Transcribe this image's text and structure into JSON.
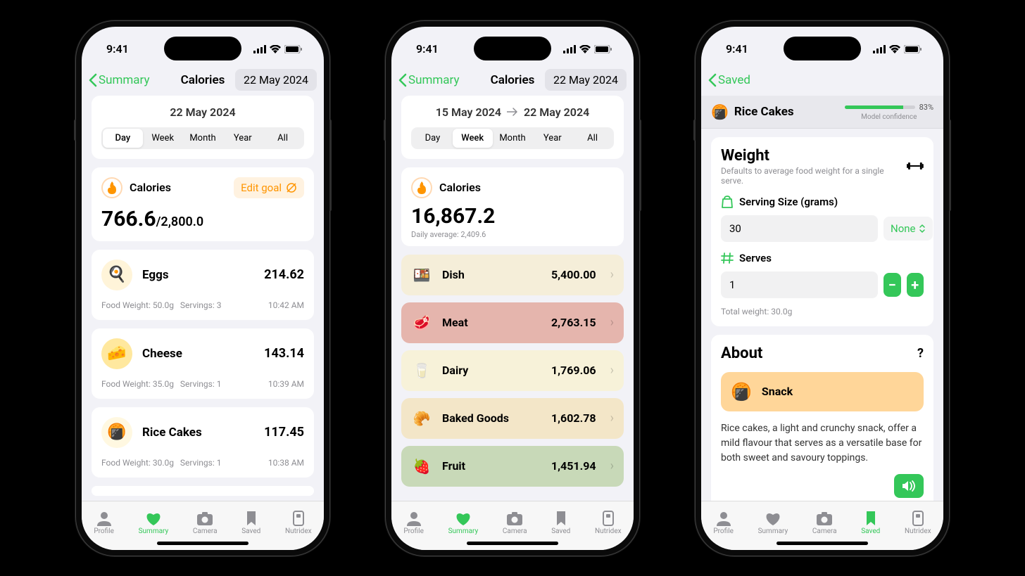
{
  "status": {
    "time": "9:41"
  },
  "nav": {
    "back": "Summary",
    "title": "Calories",
    "date_pill": "22 May 2024",
    "saved_back": "Saved"
  },
  "tabs": {
    "profile": "Profile",
    "summary": "Summary",
    "camera": "Camera",
    "saved": "Saved",
    "nutridex": "Nutridex"
  },
  "screen1": {
    "date": "22 May 2024",
    "segments": [
      "Day",
      "Week",
      "Month",
      "Year",
      "All"
    ],
    "calories_label": "Calories",
    "edit_goal": "Edit goal",
    "current": "766.6",
    "sep": "/",
    "goal": "2,800.0",
    "foods": [
      {
        "name": "Eggs",
        "val": "214.62",
        "weight": "Food Weight: 50.0g",
        "servings": "Servings: 3",
        "time": "10:42 AM",
        "emoji": "🍳",
        "bg": "#fff4d9"
      },
      {
        "name": "Cheese",
        "val": "143.14",
        "weight": "Food Weight: 35.0g",
        "servings": "Servings: 1",
        "time": "10:39 AM",
        "emoji": "🧀",
        "bg": "#ffe89e"
      },
      {
        "name": "Rice Cakes",
        "val": "117.45",
        "weight": "Food Weight: 30.0g",
        "servings": "Servings: 1",
        "time": "10:38 AM",
        "emoji": "🍘",
        "bg": "#fff8e1"
      }
    ]
  },
  "screen2": {
    "date_from": "15 May 2024",
    "date_to": "22 May 2024",
    "segments": [
      "Day",
      "Week",
      "Month",
      "Year",
      "All"
    ],
    "calories_label": "Calories",
    "total": "16,867.2",
    "daily_avg": "Daily average: 2,409.6",
    "cats": [
      {
        "name": "Dish",
        "val": "5,400.00",
        "bg": "#f5eed9",
        "emoji": "🍱"
      },
      {
        "name": "Meat",
        "val": "2,763.15",
        "bg": "#e5b5ad",
        "emoji": "🥩"
      },
      {
        "name": "Dairy",
        "val": "1,769.06",
        "bg": "#f7f2d9",
        "emoji": "🥛"
      },
      {
        "name": "Baked Goods",
        "val": "1,602.78",
        "bg": "#f3e6c8",
        "emoji": "🥐"
      },
      {
        "name": "Fruit",
        "val": "1,451.94",
        "bg": "#c8d9b8",
        "emoji": "🍓"
      }
    ]
  },
  "screen3": {
    "title": "Rice Cakes",
    "confidence_pct": "83%",
    "confidence_val": 83,
    "confidence_label": "Model confidence",
    "weight_title": "Weight",
    "weight_sub": "Defaults to average food weight for a single serve.",
    "serving_label": "Serving Size (grams)",
    "serving_val": "30",
    "none": "None",
    "serves_label": "Serves",
    "serves_val": "1",
    "total_weight": "Total weight: 30.0g",
    "about_title": "About",
    "snack_label": "Snack",
    "about_text": "Rice cakes, a light and crunchy snack, offer a mild flavour that serves as a versatile base for both sweet and savoury toppings."
  }
}
